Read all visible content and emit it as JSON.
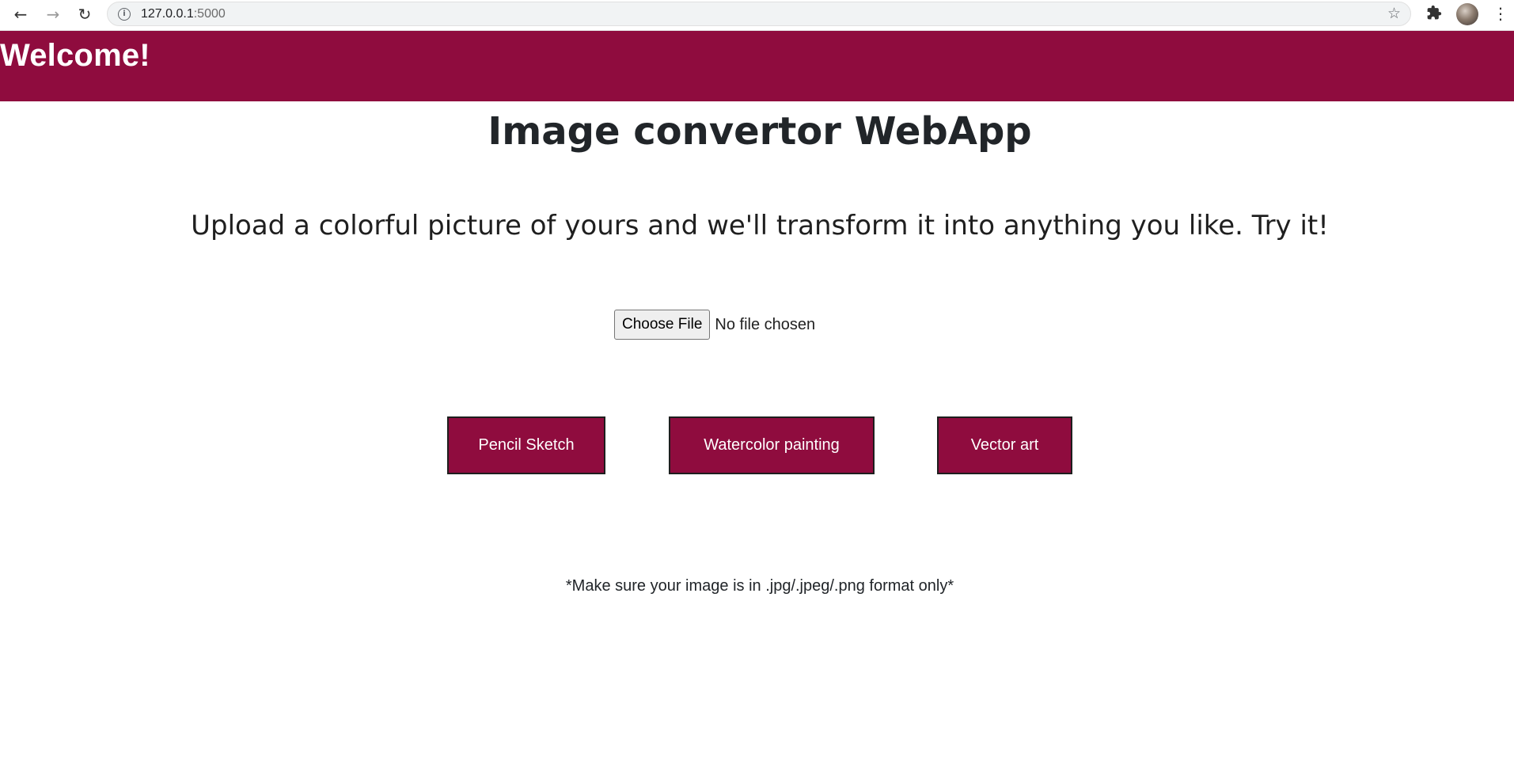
{
  "browser": {
    "url_host": "127.0.0.1",
    "url_port": ":5000",
    "icons": {
      "back": "arrow-left-icon",
      "forward": "arrow-right-icon",
      "reload": "reload-icon",
      "info": "info-icon",
      "bookmark": "star-icon",
      "extensions": "puzzle-icon",
      "menu": "kebab-menu-icon"
    }
  },
  "header": {
    "title": "Welcome!",
    "background": "#8f0c3e"
  },
  "main": {
    "title": "Image convertor WebApp",
    "subtitle": "Upload a colorful picture of yours and we'll transform it into anything you like. Try it!",
    "file_input": {
      "button_label": "Choose File",
      "status": "No file chosen"
    },
    "actions": [
      {
        "label": "Pencil Sketch"
      },
      {
        "label": "Watercolor painting"
      },
      {
        "label": "Vector art"
      }
    ],
    "note": "*Make sure your image is in .jpg/.jpeg/.png format only*"
  },
  "colors": {
    "accent": "#8f0c3e",
    "button_text": "#ffffff",
    "text": "#212529"
  }
}
